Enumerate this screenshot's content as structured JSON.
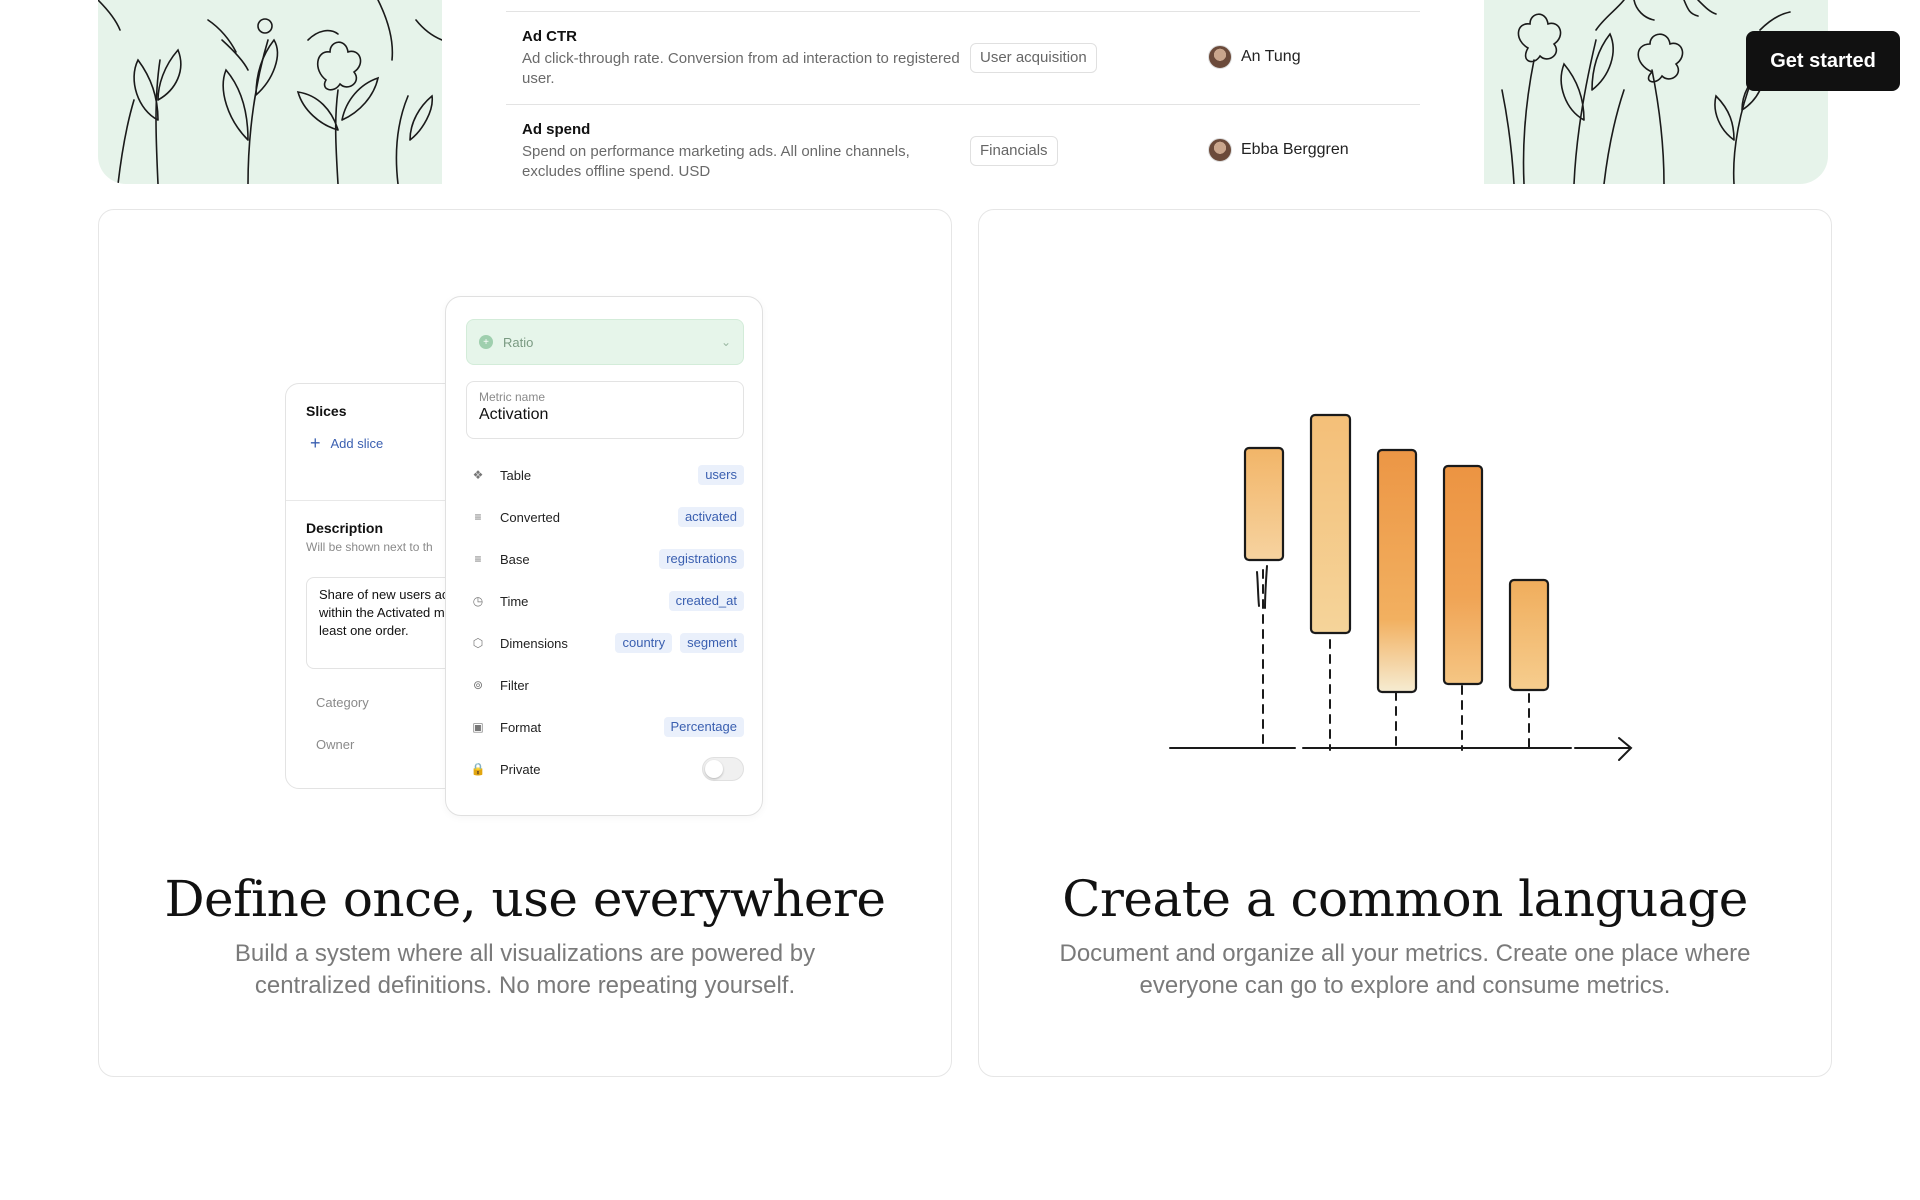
{
  "header": {
    "cta_label": "Get started"
  },
  "metrics_table": {
    "rows": [
      {
        "name": "Ad CTR",
        "description": "Ad click-through rate. Conversion from ad interaction to registered user.",
        "category": "User acquisition",
        "owner": "An Tung"
      },
      {
        "name": "Ad spend",
        "description": "Spend on performance marketing ads. All online channels, excludes offline spend. USD",
        "category": "Financials",
        "owner": "Ebba Berggren"
      }
    ]
  },
  "feature_left": {
    "title": "Define once, use everywhere",
    "subtitle": "Build a system where all visualizations are powered by centralized definitions. No more repeating yourself.",
    "slices_panel": {
      "title": "Slices",
      "add_label": "Add slice",
      "description_title": "Description",
      "description_hint": "Will be shown next to th",
      "description_text": "Share of new users activated within the Activated means th least one order.",
      "category_label": "Category",
      "owner_label": "Owner"
    },
    "metric_panel": {
      "type_value": "Ratio",
      "name_label": "Metric name",
      "name_value": "Activation",
      "properties": [
        {
          "label": "Table",
          "tags": [
            "users"
          ],
          "icon": "table-icon"
        },
        {
          "label": "Converted",
          "tags": [
            "activated"
          ],
          "icon": "converted-icon"
        },
        {
          "label": "Base",
          "tags": [
            "registrations"
          ],
          "icon": "base-icon"
        },
        {
          "label": "Time",
          "tags": [
            "created_at"
          ],
          "icon": "clock-icon"
        },
        {
          "label": "Dimensions",
          "tags": [
            "country",
            "segment"
          ],
          "icon": "cube-icon"
        },
        {
          "label": "Filter",
          "tags": [],
          "icon": "filter-icon"
        },
        {
          "label": "Format",
          "tags": [
            "Percentage"
          ],
          "icon": "format-icon"
        },
        {
          "label": "Private",
          "tags": [],
          "icon": "lock-icon",
          "toggle": false
        }
      ]
    }
  },
  "feature_right": {
    "title": "Create a common language",
    "subtitle": "Document and organize all your metrics. Create one place where everyone can go to explore and consume metrics."
  },
  "colors": {
    "hero_green": "#e6f3ea",
    "tag_blue": "#3a5fb0",
    "tag_bg": "#eaf0fb",
    "bar_orange": "#ec9a45",
    "cta_black": "#111111"
  }
}
